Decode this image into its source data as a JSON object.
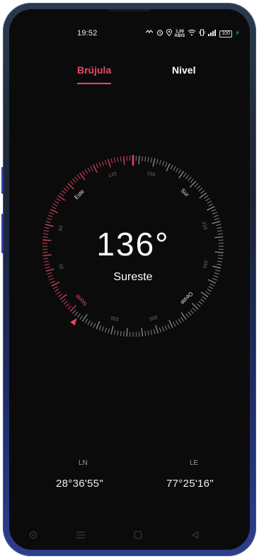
{
  "status": {
    "time": "19:52",
    "speed_value": "1,00",
    "speed_unit": "KB/S",
    "battery": "100"
  },
  "tabs": [
    {
      "label": "Brújula",
      "active": true
    },
    {
      "label": "Nivel",
      "active": false
    }
  ],
  "compass": {
    "heading_degrees": 136,
    "heading_text": "136°",
    "direction_label": "Sureste",
    "cardinal_labels": [
      "Norte",
      "Este",
      "Sur",
      "Oeste"
    ],
    "degree_labels": [
      "30",
      "60",
      "120",
      "150",
      "210",
      "240",
      "300",
      "330"
    ],
    "accent_color": "#e84a5f"
  },
  "coordinates": {
    "lat_label": "LN",
    "lat_value": "28°36'55\"",
    "lon_label": "LE",
    "lon_value": "77°25'16\""
  },
  "navbar": {
    "icons": [
      "assistant-icon",
      "menu-icon",
      "home-icon",
      "back-icon"
    ]
  }
}
